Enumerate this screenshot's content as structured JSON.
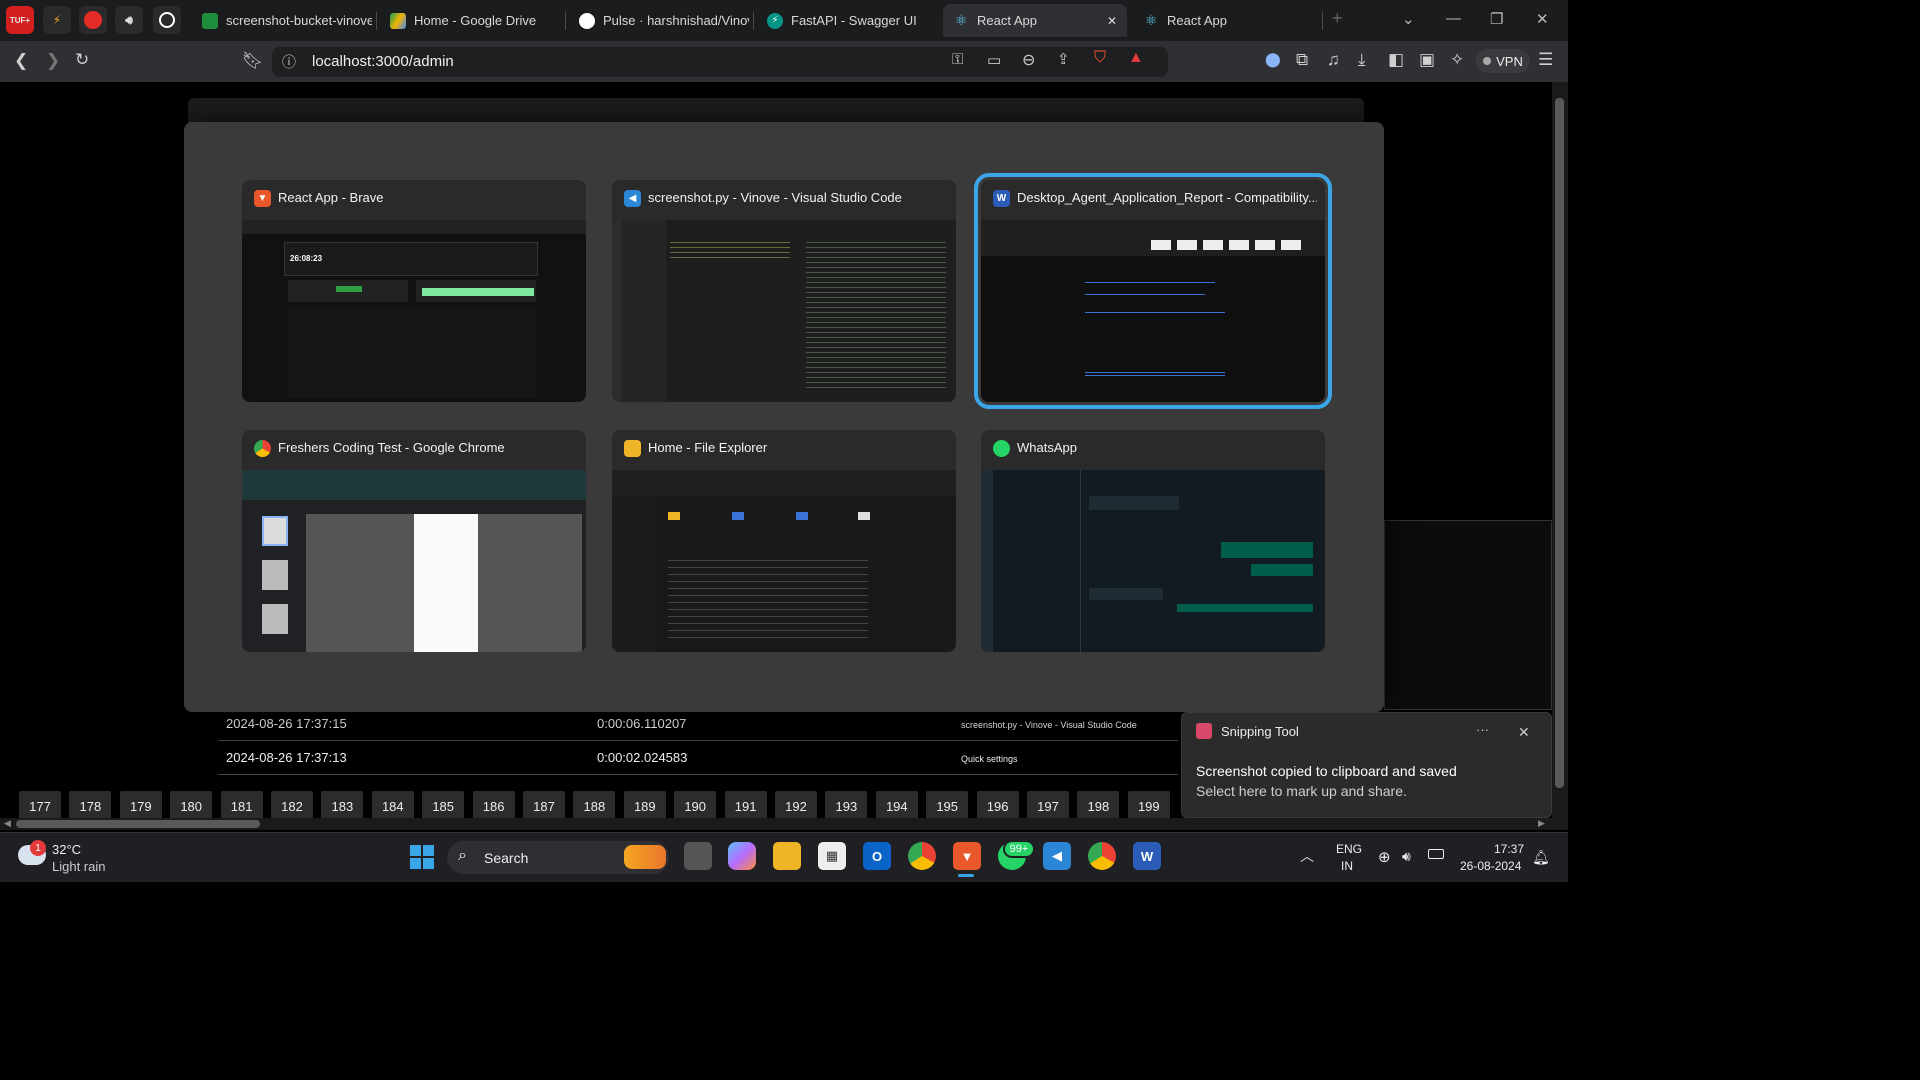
{
  "browser": {
    "pinned_tabs": [
      {
        "icon": "tuf-icon",
        "label": "TUF+"
      },
      {
        "icon": "lightning-icon",
        "label": ""
      },
      {
        "icon": "youtube-music-icon",
        "label": ""
      },
      {
        "icon": "audio-icon",
        "label": ""
      },
      {
        "icon": "chatgpt-icon",
        "label": ""
      }
    ],
    "tabs": [
      {
        "title": "screenshot-bucket-vinove",
        "icon": "sheets-icon"
      },
      {
        "title": "Home - Google Drive",
        "icon": "drive-icon"
      },
      {
        "title": "Pulse · harshnishad/Vinov",
        "icon": "github-icon"
      },
      {
        "title": "FastAPI - Swagger UI",
        "icon": "fastapi-icon"
      },
      {
        "title": "React App",
        "icon": "react-icon",
        "active": true
      },
      {
        "title": "React App",
        "icon": "react-icon"
      }
    ],
    "url": "localhost:3000/admin",
    "vpn_label": "VPN",
    "new_tab": "+",
    "close_tab": "✕"
  },
  "page": {
    "rows": [
      {
        "time": "2024-08-26 17:37:15",
        "duration": "0:00:06.110207",
        "app": "screenshot.py - Vinove - Visual Studio Code"
      },
      {
        "time": "2024-08-26 17:37:13",
        "duration": "0:00:02.024583",
        "app": "Quick settings"
      }
    ],
    "pages": [
      "177",
      "178",
      "179",
      "180",
      "181",
      "182",
      "183",
      "184",
      "185",
      "186",
      "187",
      "188",
      "189",
      "190",
      "191",
      "192",
      "193",
      "194",
      "195",
      "196",
      "197",
      "198",
      "199"
    ]
  },
  "switcher": {
    "windows": [
      {
        "title": "React App - Brave",
        "icon": "brave-icon",
        "color": "#e8582a"
      },
      {
        "title": "screenshot.py - Vinove - Visual Studio Code",
        "icon": "vscode-icon",
        "color": "#2b86d6"
      },
      {
        "title": "Desktop_Agent_Application_Report  -  Compatibility...",
        "icon": "word-icon",
        "color": "#2b5cb8",
        "selected": true
      },
      {
        "title": "Freshers Coding Test - Google Chrome",
        "icon": "chrome-icon",
        "color": "#4285f4"
      },
      {
        "title": "Home - File Explorer",
        "icon": "folder-icon",
        "color": "#f0b429"
      },
      {
        "title": "WhatsApp",
        "icon": "whatsapp-icon",
        "color": "#25d366"
      }
    ]
  },
  "toast": {
    "app": "Snipping Tool",
    "title": "Screenshot copied to clipboard and saved",
    "body": "Select here to mark up and share.",
    "more": "···",
    "close": "✕"
  },
  "taskbar": {
    "weather_temp": "32°C",
    "weather_desc": "Light rain",
    "weather_badge": "1",
    "search_label": "Search",
    "whatsapp_badge": "99+",
    "lang_top": "ENG",
    "lang_bottom": "IN",
    "time": "17:37",
    "date": "26-08-2024"
  },
  "colors": {
    "accent": "#3aa6e8",
    "taskbar_bg": "#1f1f24",
    "switcher_bg": "#3a3a3a"
  }
}
